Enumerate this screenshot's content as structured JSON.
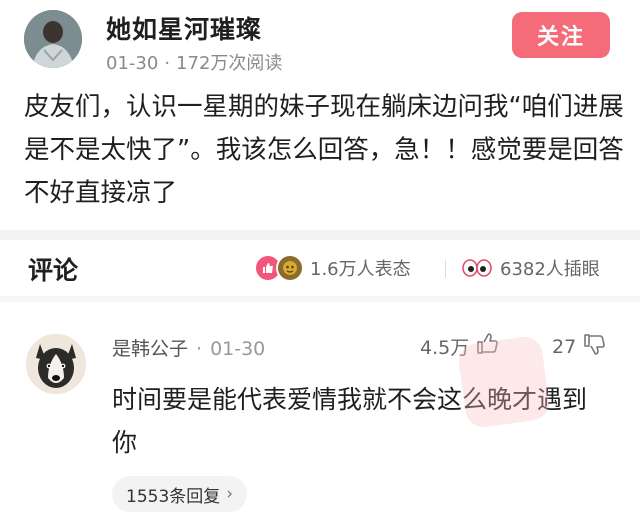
{
  "post": {
    "author": "她如星河璀璨",
    "date": "01-30",
    "views": "172万次阅读",
    "follow_label": "关注",
    "body": "皮友们，认识一星期的妹子现在躺床边问我“咱们进展是不是太快了”。我该怎么回答，急！！感觉要是回答不好直接凉了"
  },
  "comments_bar": {
    "title": "评论",
    "reactions_text": "1.6万人表态",
    "eyes_text": "6382人插眼"
  },
  "comment": {
    "user": "是韩公子",
    "date": "01-30",
    "likes": "4.5万",
    "dislikes": "27",
    "text": "时间要是能代表爱情我就不会这么晚才遇到你",
    "replies_label": "1553条回复"
  },
  "colors": {
    "follow_bg": "#f46c7a",
    "heart": "#f2567a"
  }
}
